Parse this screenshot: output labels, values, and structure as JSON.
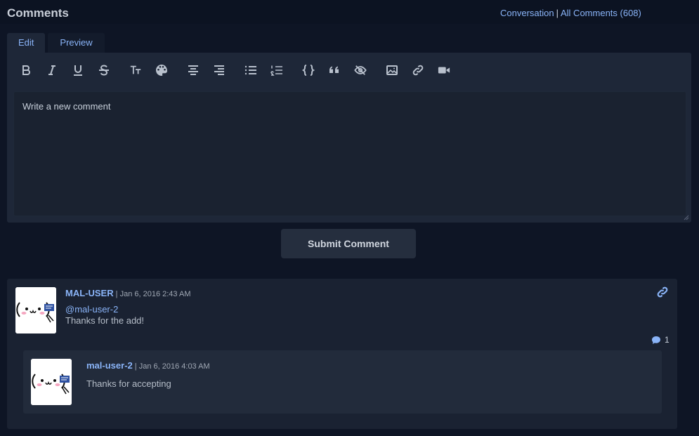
{
  "header": {
    "title": "Comments",
    "conversation_link": "Conversation",
    "separator": "|",
    "all_comments_link": "All Comments (608)"
  },
  "tabs": [
    {
      "label": "Edit",
      "active": true
    },
    {
      "label": "Preview",
      "active": false
    }
  ],
  "toolbar": {
    "icons": [
      "bold-icon",
      "italic-icon",
      "underline-icon",
      "strikethrough-icon",
      "text-size-icon",
      "palette-icon",
      "align-center-icon",
      "align-right-icon",
      "bullet-list-icon",
      "numbered-list-icon",
      "code-icon",
      "quote-icon",
      "spoiler-icon",
      "image-icon",
      "link-icon",
      "video-icon"
    ]
  },
  "editor": {
    "placeholder": "Write a new comment",
    "value": ""
  },
  "submit": {
    "label": "Submit Comment"
  },
  "comments": [
    {
      "user": "MAL-USER",
      "meta": " | Jan 6, 2016 2:43 AM",
      "mention": "@mal-user-2",
      "text": "Thanks for the add!",
      "reply_count": "1",
      "replies": [
        {
          "user": "mal-user-2",
          "meta": " | Jan 6, 2016 4:03 AM",
          "text": "Thanks for accepting"
        }
      ]
    }
  ],
  "colors": {
    "background": "#0e1525",
    "panel": "#1e2738",
    "accent": "#8ab4f8"
  }
}
